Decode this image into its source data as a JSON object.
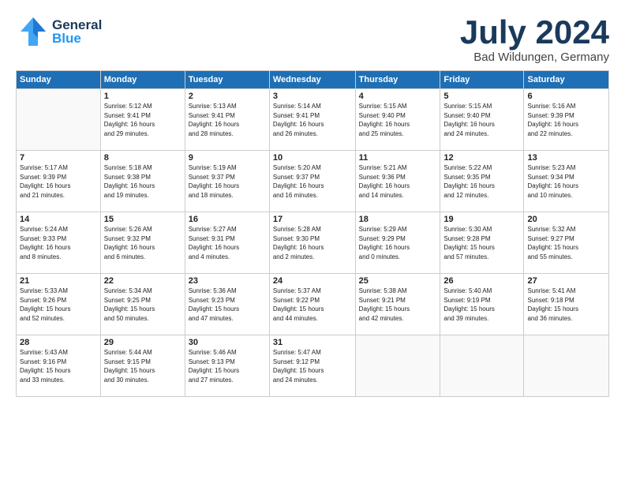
{
  "header": {
    "logo_general": "General",
    "logo_blue": "Blue",
    "month": "July 2024",
    "location": "Bad Wildungen, Germany"
  },
  "weekdays": [
    "Sunday",
    "Monday",
    "Tuesday",
    "Wednesday",
    "Thursday",
    "Friday",
    "Saturday"
  ],
  "weeks": [
    [
      {
        "num": "",
        "info": ""
      },
      {
        "num": "1",
        "info": "Sunrise: 5:12 AM\nSunset: 9:41 PM\nDaylight: 16 hours\nand 29 minutes."
      },
      {
        "num": "2",
        "info": "Sunrise: 5:13 AM\nSunset: 9:41 PM\nDaylight: 16 hours\nand 28 minutes."
      },
      {
        "num": "3",
        "info": "Sunrise: 5:14 AM\nSunset: 9:41 PM\nDaylight: 16 hours\nand 26 minutes."
      },
      {
        "num": "4",
        "info": "Sunrise: 5:15 AM\nSunset: 9:40 PM\nDaylight: 16 hours\nand 25 minutes."
      },
      {
        "num": "5",
        "info": "Sunrise: 5:15 AM\nSunset: 9:40 PM\nDaylight: 16 hours\nand 24 minutes."
      },
      {
        "num": "6",
        "info": "Sunrise: 5:16 AM\nSunset: 9:39 PM\nDaylight: 16 hours\nand 22 minutes."
      }
    ],
    [
      {
        "num": "7",
        "info": "Sunrise: 5:17 AM\nSunset: 9:39 PM\nDaylight: 16 hours\nand 21 minutes."
      },
      {
        "num": "8",
        "info": "Sunrise: 5:18 AM\nSunset: 9:38 PM\nDaylight: 16 hours\nand 19 minutes."
      },
      {
        "num": "9",
        "info": "Sunrise: 5:19 AM\nSunset: 9:37 PM\nDaylight: 16 hours\nand 18 minutes."
      },
      {
        "num": "10",
        "info": "Sunrise: 5:20 AM\nSunset: 9:37 PM\nDaylight: 16 hours\nand 16 minutes."
      },
      {
        "num": "11",
        "info": "Sunrise: 5:21 AM\nSunset: 9:36 PM\nDaylight: 16 hours\nand 14 minutes."
      },
      {
        "num": "12",
        "info": "Sunrise: 5:22 AM\nSunset: 9:35 PM\nDaylight: 16 hours\nand 12 minutes."
      },
      {
        "num": "13",
        "info": "Sunrise: 5:23 AM\nSunset: 9:34 PM\nDaylight: 16 hours\nand 10 minutes."
      }
    ],
    [
      {
        "num": "14",
        "info": "Sunrise: 5:24 AM\nSunset: 9:33 PM\nDaylight: 16 hours\nand 8 minutes."
      },
      {
        "num": "15",
        "info": "Sunrise: 5:26 AM\nSunset: 9:32 PM\nDaylight: 16 hours\nand 6 minutes."
      },
      {
        "num": "16",
        "info": "Sunrise: 5:27 AM\nSunset: 9:31 PM\nDaylight: 16 hours\nand 4 minutes."
      },
      {
        "num": "17",
        "info": "Sunrise: 5:28 AM\nSunset: 9:30 PM\nDaylight: 16 hours\nand 2 minutes."
      },
      {
        "num": "18",
        "info": "Sunrise: 5:29 AM\nSunset: 9:29 PM\nDaylight: 16 hours\nand 0 minutes."
      },
      {
        "num": "19",
        "info": "Sunrise: 5:30 AM\nSunset: 9:28 PM\nDaylight: 15 hours\nand 57 minutes."
      },
      {
        "num": "20",
        "info": "Sunrise: 5:32 AM\nSunset: 9:27 PM\nDaylight: 15 hours\nand 55 minutes."
      }
    ],
    [
      {
        "num": "21",
        "info": "Sunrise: 5:33 AM\nSunset: 9:26 PM\nDaylight: 15 hours\nand 52 minutes."
      },
      {
        "num": "22",
        "info": "Sunrise: 5:34 AM\nSunset: 9:25 PM\nDaylight: 15 hours\nand 50 minutes."
      },
      {
        "num": "23",
        "info": "Sunrise: 5:36 AM\nSunset: 9:23 PM\nDaylight: 15 hours\nand 47 minutes."
      },
      {
        "num": "24",
        "info": "Sunrise: 5:37 AM\nSunset: 9:22 PM\nDaylight: 15 hours\nand 44 minutes."
      },
      {
        "num": "25",
        "info": "Sunrise: 5:38 AM\nSunset: 9:21 PM\nDaylight: 15 hours\nand 42 minutes."
      },
      {
        "num": "26",
        "info": "Sunrise: 5:40 AM\nSunset: 9:19 PM\nDaylight: 15 hours\nand 39 minutes."
      },
      {
        "num": "27",
        "info": "Sunrise: 5:41 AM\nSunset: 9:18 PM\nDaylight: 15 hours\nand 36 minutes."
      }
    ],
    [
      {
        "num": "28",
        "info": "Sunrise: 5:43 AM\nSunset: 9:16 PM\nDaylight: 15 hours\nand 33 minutes."
      },
      {
        "num": "29",
        "info": "Sunrise: 5:44 AM\nSunset: 9:15 PM\nDaylight: 15 hours\nand 30 minutes."
      },
      {
        "num": "30",
        "info": "Sunrise: 5:46 AM\nSunset: 9:13 PM\nDaylight: 15 hours\nand 27 minutes."
      },
      {
        "num": "31",
        "info": "Sunrise: 5:47 AM\nSunset: 9:12 PM\nDaylight: 15 hours\nand 24 minutes."
      },
      {
        "num": "",
        "info": ""
      },
      {
        "num": "",
        "info": ""
      },
      {
        "num": "",
        "info": ""
      }
    ]
  ]
}
